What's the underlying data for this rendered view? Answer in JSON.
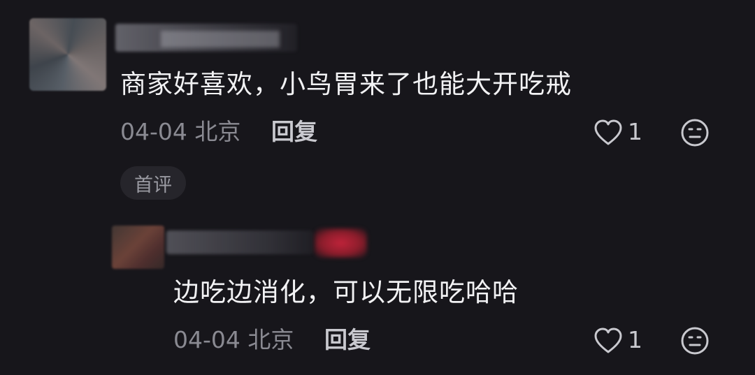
{
  "comments": [
    {
      "text": "商家好喜欢，小鸟胃来了也能大开吃戒",
      "date": "04-04",
      "location": "北京",
      "reply_label": "回复",
      "like_count": "1",
      "badge": "首评"
    },
    {
      "text": "边吃边消化，可以无限吃哈哈",
      "date": "04-04",
      "location": "北京",
      "reply_label": "回复",
      "like_count": "1"
    }
  ],
  "icons": {
    "like": "heart-icon",
    "react": "emoji-icon"
  },
  "colors": {
    "background": "#17161b",
    "text": "#f2f2f4",
    "meta": "#8a8a92"
  }
}
